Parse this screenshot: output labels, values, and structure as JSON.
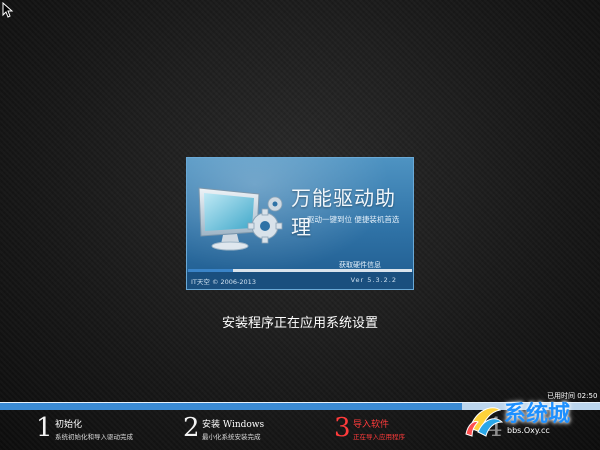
{
  "colors": {
    "accent_blue": "#3b8bd4",
    "active_red": "#ff3b3b",
    "background": "#1a1a1a"
  },
  "splash": {
    "title": "万能驱动助理",
    "tagline": "驱动一键到位 便捷装机首选",
    "hw_info": "获取硬件信息",
    "copyright": "IT天空 © 2006-2013",
    "version": "Ver 5.3.2.2",
    "progress": 0.2
  },
  "status_message": "安装程序正在应用系统设置",
  "elapsed": "已用时间 02:50",
  "overall_progress": 0.77,
  "steps": [
    {
      "num": "1",
      "title": "初始化",
      "desc": "系统初始化和导入驱动完成",
      "state": "done"
    },
    {
      "num": "2",
      "title": "安装 Windows",
      "desc": "最小化系统安装完成",
      "state": "done"
    },
    {
      "num": "3",
      "title": "导入软件",
      "desc": "正在导入应用程序",
      "state": "active"
    },
    {
      "num": "4",
      "title": "",
      "desc": "",
      "state": "pending"
    }
  ],
  "watermark": {
    "text": "系统城",
    "url": "bbs.Oxy.cc"
  }
}
